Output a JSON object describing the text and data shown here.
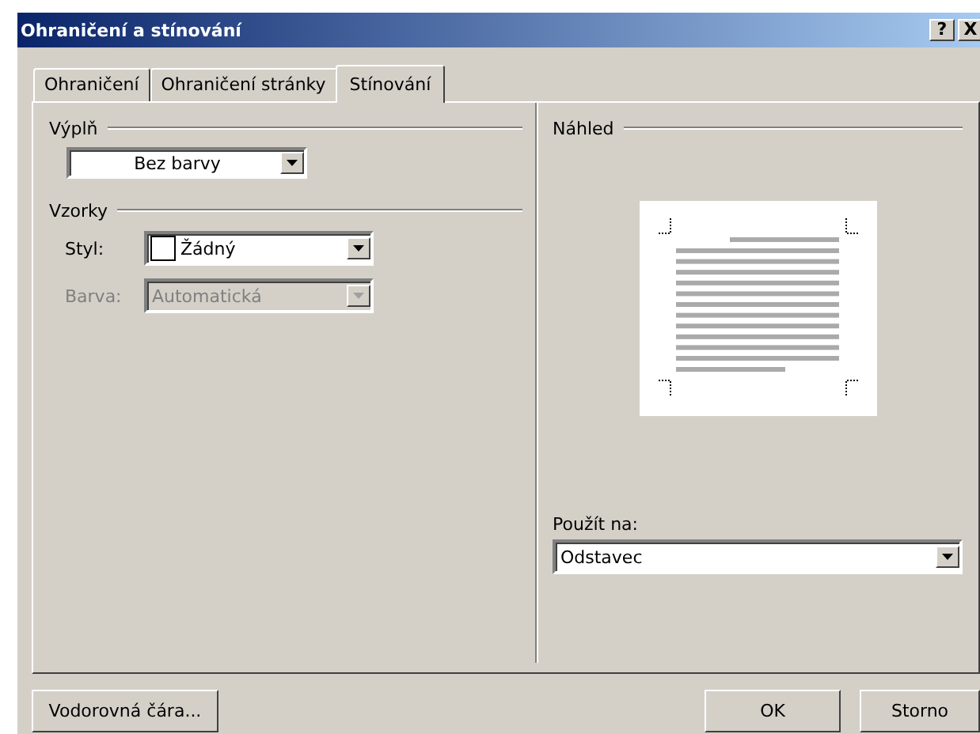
{
  "window": {
    "title": "Ohraničení a stínování",
    "title_buttons": [
      "?",
      "X"
    ]
  },
  "tabs": [
    {
      "label": "Ohraničení",
      "selected": false
    },
    {
      "label": "Ohraničení stránky",
      "selected": false
    },
    {
      "label": "Stínování",
      "selected": true
    }
  ],
  "fill": {
    "heading": "Výplň",
    "value": "Bez barvy"
  },
  "patterns": {
    "heading": "Vzorky",
    "rows": [
      {
        "label": "Styl:",
        "value": "Žádný",
        "swatch": true,
        "disabled": false
      },
      {
        "label": "Barva:",
        "value": "Automatická",
        "swatch": false,
        "disabled": true
      }
    ]
  },
  "preview": {
    "heading": "Náhled",
    "apply_label": "Použít na:",
    "apply_value": "Odstavec"
  },
  "buttons": [
    {
      "label": "Vodorovná čára...",
      "kind": "left"
    },
    {
      "label": "OK",
      "kind": "right"
    },
    {
      "label": "Storno",
      "kind": "right"
    }
  ]
}
